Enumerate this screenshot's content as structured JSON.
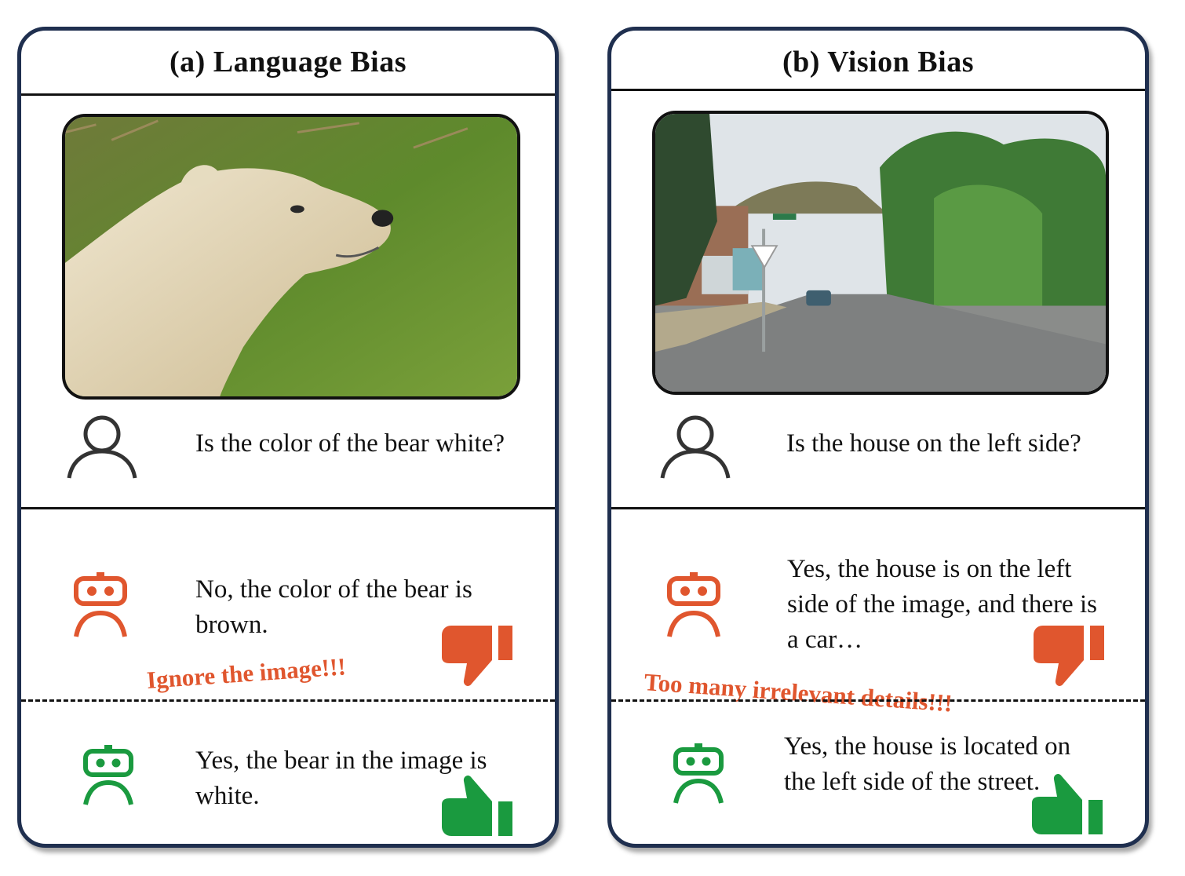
{
  "panels": [
    {
      "title": "(a) Language Bias",
      "question": "Is the color of the bear white?",
      "bad_answer": "No, the color of the bear is brown.",
      "bad_note": "Ignore the image!!!",
      "good_answer": "Yes, the bear in the image is white.",
      "image": "polar-bear-photo"
    },
    {
      "title": "(b) Vision Bias",
      "question": "Is the house on the left side?",
      "bad_answer": "Yes, the house is on the left side of the image, and there is a car…",
      "bad_note": "Too many irrelevant details!!!",
      "good_answer": "Yes, the house is located on the left side of the street.",
      "image": "street-scene-photo"
    }
  ],
  "icons": {
    "user": "user-icon",
    "bad_robot": "robot-icon",
    "good_robot": "robot-icon",
    "thumbs_down": "thumbs-down-icon",
    "thumbs_up": "thumbs-up-icon"
  },
  "colors": {
    "bad": "#e0562e",
    "good": "#1a9a3f",
    "border": "#1f2f4f"
  }
}
